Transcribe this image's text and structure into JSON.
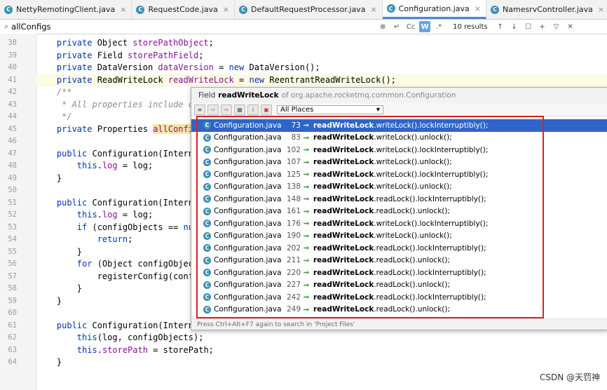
{
  "tabs": [
    {
      "label": "NettyRemotingClient.java",
      "icon": "class-icon"
    },
    {
      "label": "RequestCode.java",
      "icon": "class-icon"
    },
    {
      "label": "DefaultRequestProcessor.java",
      "icon": "class-icon"
    },
    {
      "label": "Configuration.java",
      "icon": "class-icon",
      "active": true
    },
    {
      "label": "NamesrvController.java",
      "icon": "class-icon"
    },
    {
      "label": "NamesrvStartup.java",
      "icon": "class-icon"
    }
  ],
  "search": {
    "value": "allConfigs",
    "match_case": "Cc",
    "words": "W",
    "regex": ".*",
    "results": "10 results"
  },
  "code_lines": [
    {
      "n": "38",
      "t": "    private Object storePathObject;"
    },
    {
      "n": "39",
      "t": "    private Field storePathField;"
    },
    {
      "n": "40",
      "t": "    private DataVersion dataVersion = new DataVersion();"
    },
    {
      "n": "41",
      "t": "    private ReadWriteLock readWriteLock = new ReentrantReadWriteLock();"
    },
    {
      "n": "42",
      "t": "    /**"
    },
    {
      "n": "43",
      "t": "     * All properties include conf"
    },
    {
      "n": "44",
      "t": "     */"
    },
    {
      "n": "45",
      "t": "    private Properties allConfigs"
    },
    {
      "n": "46",
      "t": ""
    },
    {
      "n": "47",
      "t": "    public Configuration(InternalL"
    },
    {
      "n": "48",
      "t": "        this.log = log;"
    },
    {
      "n": "49",
      "t": "    }"
    },
    {
      "n": "50",
      "t": ""
    },
    {
      "n": "51",
      "t": "    public Configuration(InternalL"
    },
    {
      "n": "52",
      "t": "        this.log = log;"
    },
    {
      "n": "53",
      "t": "        if (configObjects == null"
    },
    {
      "n": "54",
      "t": "            return;"
    },
    {
      "n": "55",
      "t": "        }"
    },
    {
      "n": "56",
      "t": "        for (Object configObject :"
    },
    {
      "n": "57",
      "t": "            registerConfig(configO"
    },
    {
      "n": "58",
      "t": "        }"
    },
    {
      "n": "59",
      "t": "    }"
    },
    {
      "n": "60",
      "t": ""
    },
    {
      "n": "61",
      "t": "    public Configuration(InternalL"
    },
    {
      "n": "62",
      "t": "        this(log, configObjects);"
    },
    {
      "n": "63",
      "t": "        this.storePath = storePath;"
    },
    {
      "n": "64",
      "t": "    }"
    }
  ],
  "popup": {
    "prefix": "Field",
    "field": "readWriteLock",
    "of": "of",
    "package": "org.apache.rocketmq.common.Configuration",
    "scope": "All Places",
    "footer": "Press Ctrl+Alt+F7 again to search in 'Project Files'",
    "usages": [
      {
        "file": "Configuration.java",
        "line": "73",
        "bold": "readWriteLock",
        "rest": ".writeLock().lockInterruptibly();",
        "kind": "write"
      },
      {
        "file": "Configuration.java",
        "line": "83",
        "bold": "readWriteLock",
        "rest": ".writeLock().unlock();",
        "kind": "write"
      },
      {
        "file": "Configuration.java",
        "line": "102",
        "bold": "readWriteLock",
        "rest": ".writeLock().lockInterruptibly();",
        "kind": "write"
      },
      {
        "file": "Configuration.java",
        "line": "107",
        "bold": "readWriteLock",
        "rest": ".writeLock().unlock();",
        "kind": "write"
      },
      {
        "file": "Configuration.java",
        "line": "125",
        "bold": "readWriteLock",
        "rest": ".writeLock().lockInterruptibly();",
        "kind": "write"
      },
      {
        "file": "Configuration.java",
        "line": "138",
        "bold": "readWriteLock",
        "rest": ".writeLock().unlock();",
        "kind": "write"
      },
      {
        "file": "Configuration.java",
        "line": "148",
        "bold": "readWriteLock",
        "rest": ".readLock().lockInterruptibly();",
        "kind": "read"
      },
      {
        "file": "Configuration.java",
        "line": "161",
        "bold": "readWriteLock",
        "rest": ".readLock().unlock();",
        "kind": "read"
      },
      {
        "file": "Configuration.java",
        "line": "176",
        "bold": "readWriteLock",
        "rest": ".writeLock().lockInterruptibly();",
        "kind": "write"
      },
      {
        "file": "Configuration.java",
        "line": "190",
        "bold": "readWriteLock",
        "rest": ".writeLock().unlock();",
        "kind": "write"
      },
      {
        "file": "Configuration.java",
        "line": "202",
        "bold": "readWriteLock",
        "rest": ".readLock().lockInterruptibly();",
        "kind": "read"
      },
      {
        "file": "Configuration.java",
        "line": "211",
        "bold": "readWriteLock",
        "rest": ".readLock().unlock();",
        "kind": "read"
      },
      {
        "file": "Configuration.java",
        "line": "220",
        "bold": "readWriteLock",
        "rest": ".readLock().lockInterruptibly();",
        "kind": "read"
      },
      {
        "file": "Configuration.java",
        "line": "227",
        "bold": "readWriteLock",
        "rest": ".readLock().unlock();",
        "kind": "read"
      },
      {
        "file": "Configuration.java",
        "line": "242",
        "bold": "readWriteLock",
        "rest": ".readLock().lockInterruptibly();",
        "kind": "read"
      },
      {
        "file": "Configuration.java",
        "line": "249",
        "bold": "readWriteLock",
        "rest": ".readLock().unlock();",
        "kind": "read"
      }
    ]
  },
  "watermark": "CSDN @天罚神",
  "colors": {
    "accent": "#2f65ca",
    "highlight_box": "#e0201b",
    "keyword": "#0033b3",
    "field": "#871094"
  }
}
